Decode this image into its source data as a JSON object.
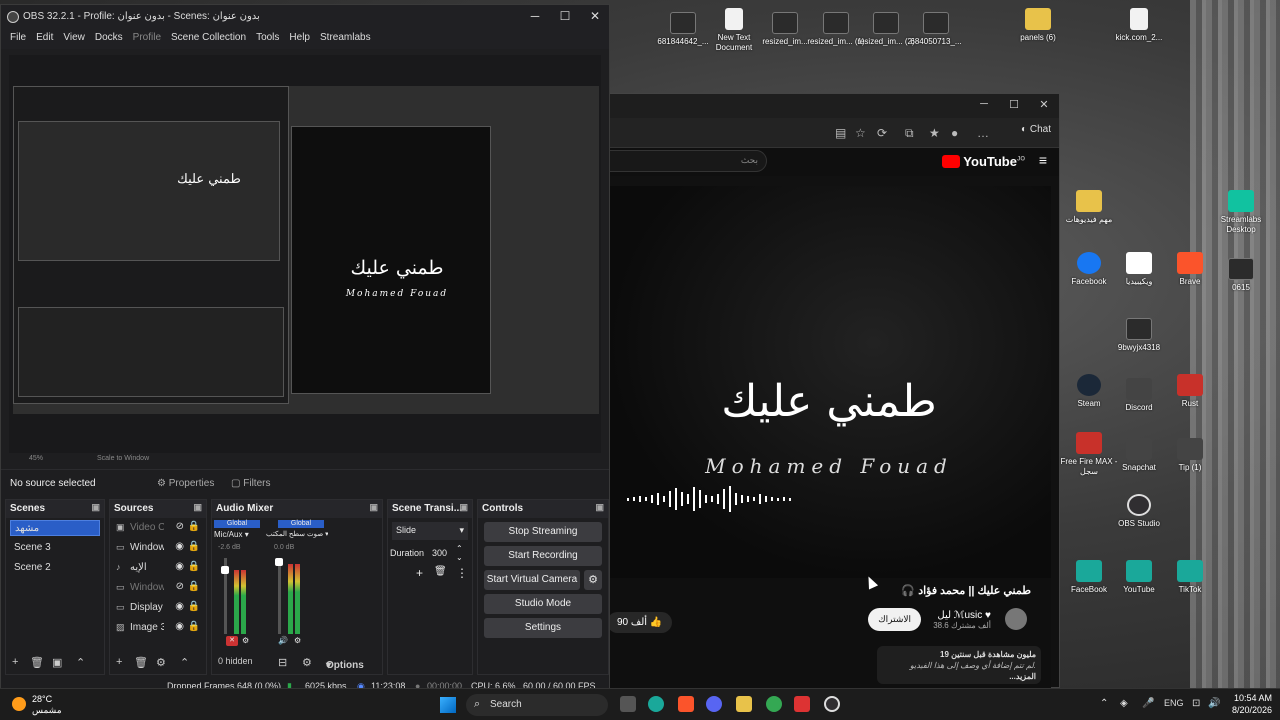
{
  "obs": {
    "title": "OBS 32.2.1 - Profile: بدون عنوان - Scenes: بدون عنوان",
    "menu": [
      "File",
      "Edit",
      "View",
      "Docks",
      "Profile",
      "Scene Collection",
      "Tools",
      "Help",
      "Streamlabs"
    ],
    "preview": {
      "zoom": "45%",
      "scale_mode": "Scale to Window",
      "ar_title": "طمني عليك",
      "en_title": "Mohamed Fouad"
    },
    "source_bar": {
      "no_source": "No source selected",
      "properties": "Properties",
      "filters": "Filters"
    },
    "scenes": {
      "title": "Scenes",
      "items": [
        "مشهد",
        "Scene 3",
        "Scene 2"
      ]
    },
    "sources": {
      "title": "Sources",
      "items": [
        {
          "name": "Video C",
          "visible": "hidden"
        },
        {
          "name": "Window",
          "visible": "shown"
        },
        {
          "name": "الإيه",
          "visible": "shown"
        },
        {
          "name": "Window",
          "visible": "hidden"
        },
        {
          "name": "Display",
          "visible": "shown"
        },
        {
          "name": "Image 3",
          "visible": "shown"
        }
      ]
    },
    "mixer": {
      "title": "Audio Mixer",
      "ch1": {
        "tag": "Global",
        "name": "Mic/Aux",
        "db": "-2.6 dB"
      },
      "ch2": {
        "tag": "Global",
        "name": "صوت سطح المكتب",
        "db": "0.0 dB"
      },
      "hidden": "0 hidden",
      "options": "Options"
    },
    "transitions": {
      "title": "Scene Transi...",
      "type": "Slide",
      "duration_label": "Duration",
      "duration": "300"
    },
    "controls": {
      "title": "Controls",
      "buttons": [
        "Stop Streaming",
        "Start Recording",
        "Start Virtual Camera",
        "Studio Mode",
        "Settings"
      ]
    },
    "status": {
      "dropped": "Dropped Frames 648 (0.0%)",
      "kbps": "6025 kbps",
      "stream_time": "11:23:08",
      "rec_time": "00:00:00",
      "cpu": "CPU: 6.6%",
      "fps": "60.00 / 60.00 FPS"
    }
  },
  "browser": {
    "chat": "Chat",
    "search_placeholder": "بحث",
    "yt_logo": "YouTube",
    "yt_region": "JO",
    "video_ar": "طمني عليك",
    "video_en": "Mohamed Fouad",
    "video_title": "طمني عليك || محمد فؤاد",
    "channel": "ليل ℳusic ♥",
    "subs": "38.6 ألف مشترك",
    "subscribe": "الاشتراك",
    "likes": "90 ألف",
    "desc_line1": "19 مليون مشاهدة قبل سنتين",
    "desc_line2": "لم تتم إضافة أي وصف إلى هذا الفيديو.",
    "desc_more": "...المزيد"
  },
  "desktop_icons": [
    {
      "label": "681844642_...",
      "kind": "img"
    },
    {
      "label": "New Text Document",
      "kind": "doc"
    },
    {
      "label": "resized_im...",
      "kind": "img"
    },
    {
      "label": "resized_im... (1)",
      "kind": "img"
    },
    {
      "label": "resized_im... (2)",
      "kind": "img"
    },
    {
      "label": "684050713_...",
      "kind": "img"
    },
    {
      "label": "panels (6)",
      "kind": "folder"
    },
    {
      "label": "kick.com_2...",
      "kind": "doc"
    },
    {
      "label": "مهم فيديوهات",
      "kind": "folder"
    },
    {
      "label": "Streamlabs Desktop",
      "kind": "green"
    },
    {
      "label": "Facebook",
      "kind": "blue"
    },
    {
      "label": "ويكيبيديا",
      "kind": "w"
    },
    {
      "label": "Brave",
      "kind": "brave"
    },
    {
      "label": "0615",
      "kind": "img"
    },
    {
      "label": "9bwyjx4318",
      "kind": "img"
    },
    {
      "label": "Steam",
      "kind": "steam"
    },
    {
      "label": "Discord",
      "kind": "dark"
    },
    {
      "label": "Rust",
      "kind": "red"
    },
    {
      "label": "Free Fire MAX - سجل",
      "kind": "red"
    },
    {
      "label": "Snapchat",
      "kind": "dark"
    },
    {
      "label": "Tip (1)",
      "kind": "dark"
    },
    {
      "label": "OBS Studio",
      "kind": "obs"
    },
    {
      "label": "FaceBook",
      "kind": "teal"
    },
    {
      "label": "YouTube",
      "kind": "teal"
    },
    {
      "label": "TikTok",
      "kind": "teal"
    }
  ],
  "taskbar": {
    "temp": "28°C",
    "weather": "مشمس",
    "search": "Search",
    "lang": "ENG",
    "time": "10:54 AM",
    "date": "8/20/2026"
  }
}
